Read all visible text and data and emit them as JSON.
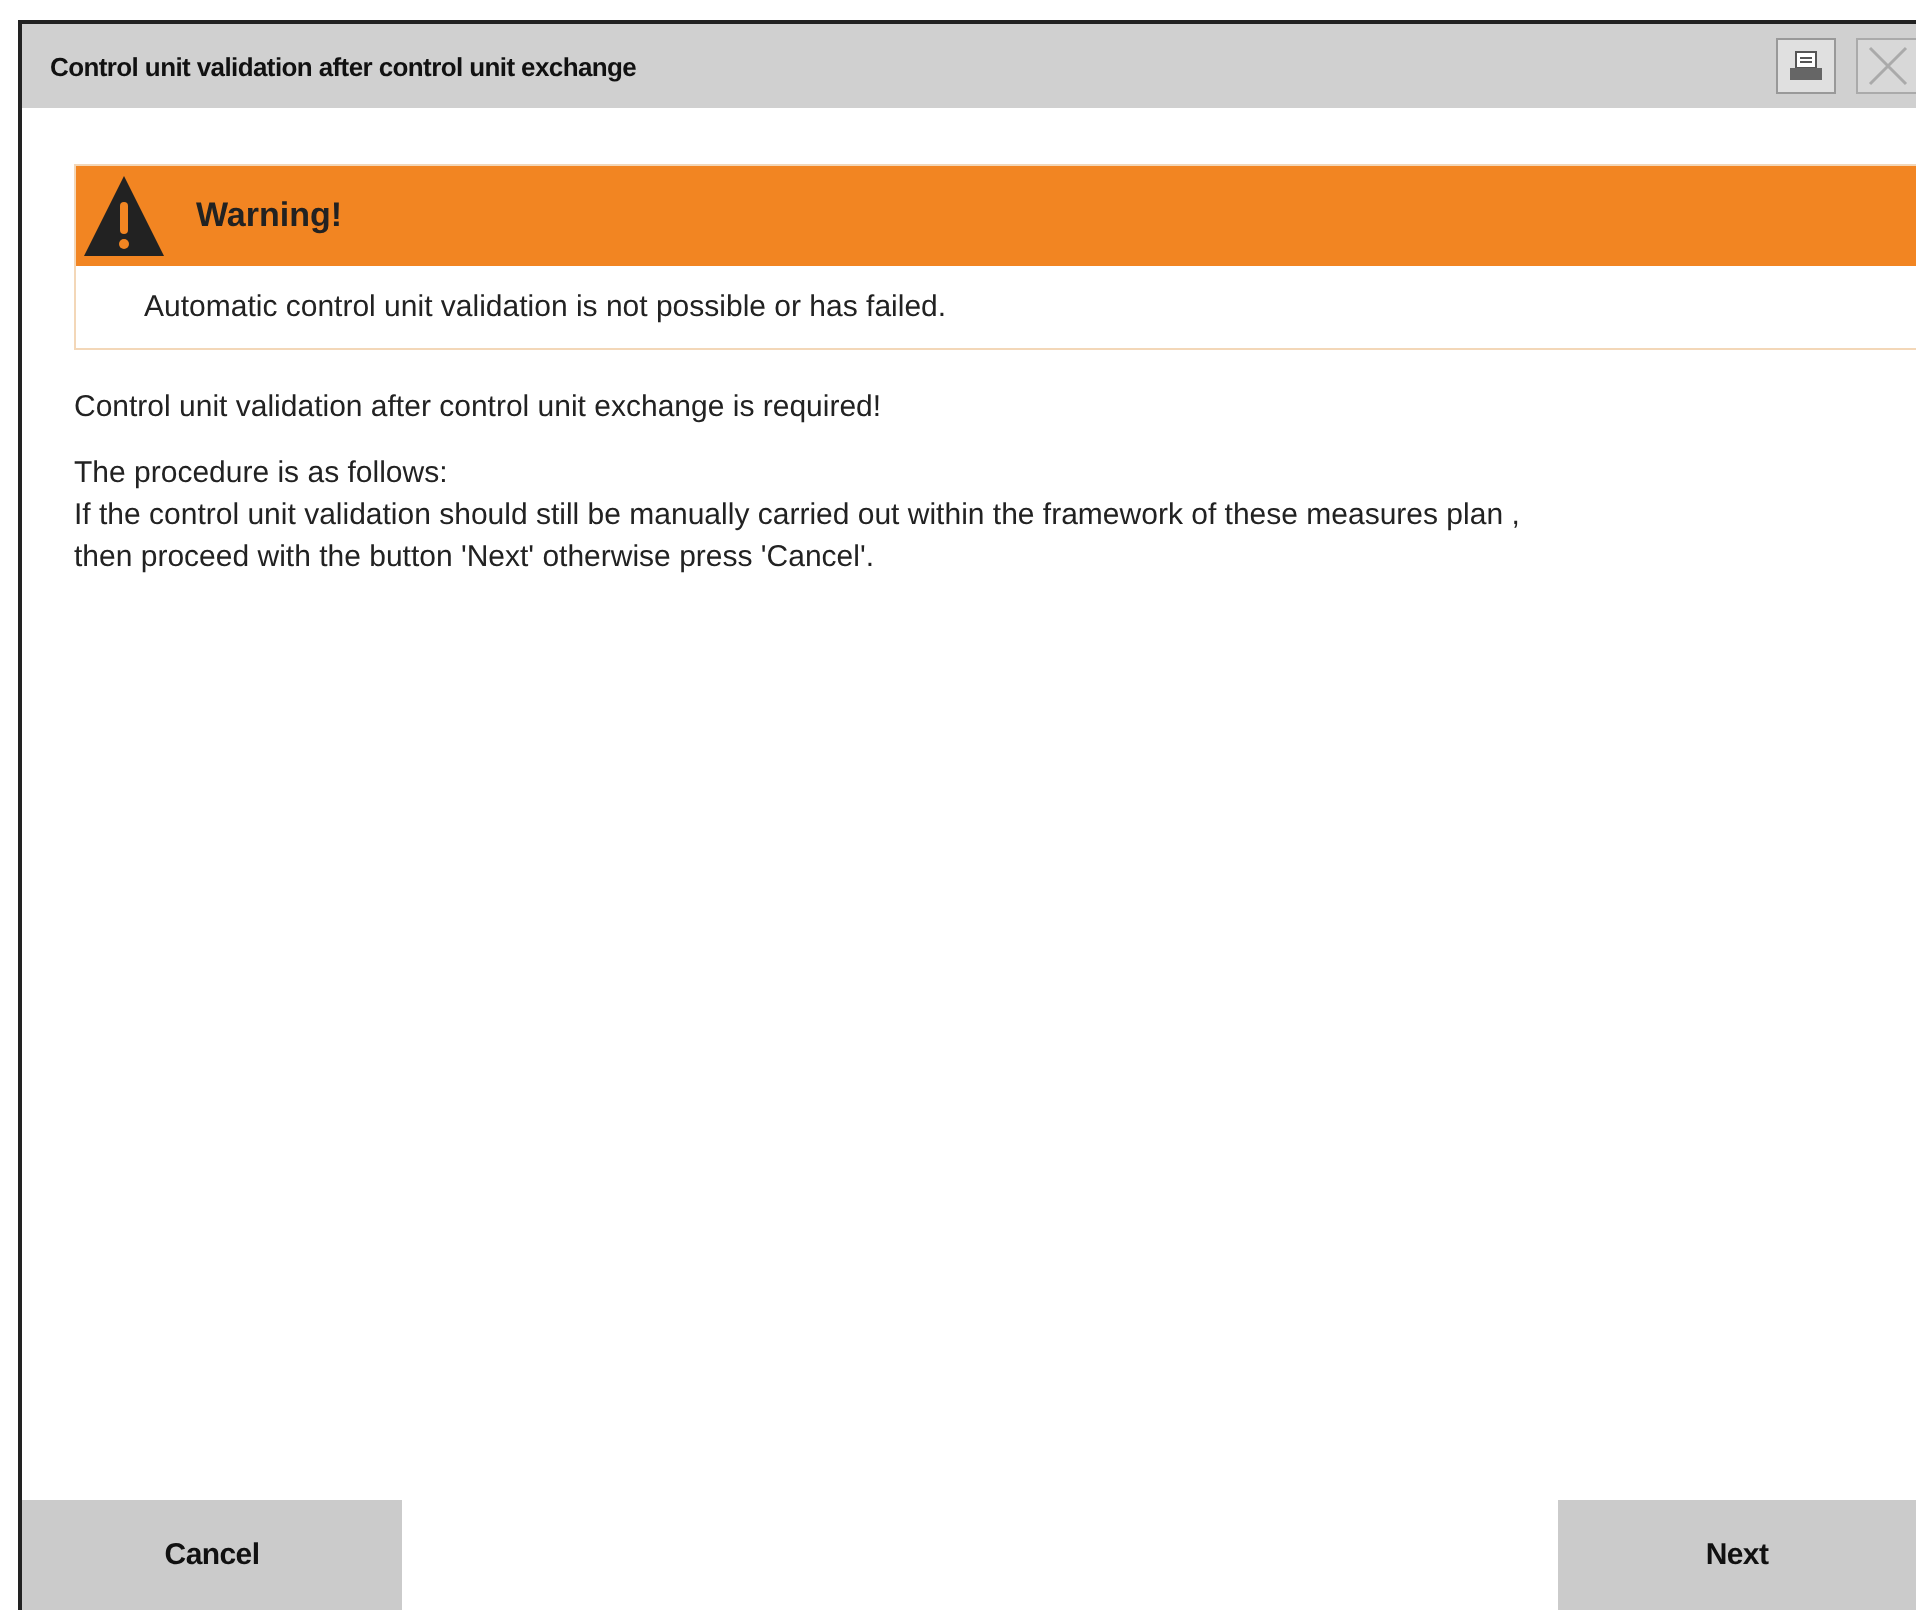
{
  "window": {
    "title": "Control unit validation after control unit exchange"
  },
  "warning": {
    "title": "Warning!",
    "message": "Automatic control unit validation is not possible or has failed."
  },
  "paragraphs": [
    "Control unit validation after control unit exchange is required!",
    "The procedure is as follows:\nIf the control unit validation should still be manually carried out within the framework of these measures plan ,\nthen proceed with the button 'Next' otherwise press 'Cancel'."
  ],
  "buttons": [
    {
      "label": "Cancel"
    },
    {
      "label": "Next"
    }
  ]
}
